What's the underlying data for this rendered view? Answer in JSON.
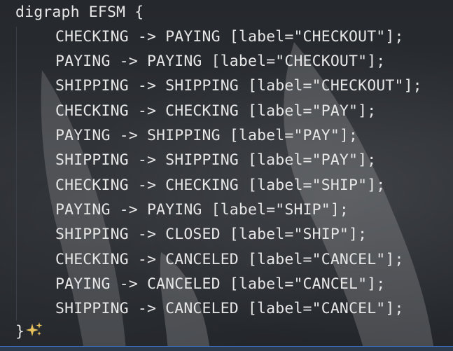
{
  "editor": {
    "header": "digraph EFSM {",
    "footer": "}",
    "lines": [
      "CHECKING -> PAYING [label=\"CHECKOUT\"];",
      "PAYING -> PAYING [label=\"CHECKOUT\"];",
      "SHIPPING -> SHIPPING [label=\"CHECKOUT\"];",
      "CHECKING -> CHECKING [label=\"PAY\"];",
      "PAYING -> SHIPPING [label=\"PAY\"];",
      "SHIPPING -> SHIPPING [label=\"PAY\"];",
      "CHECKING -> CHECKING [label=\"SHIP\"];",
      "PAYING -> PAYING [label=\"SHIP\"];",
      "SHIPPING -> CLOSED [label=\"SHIP\"];",
      "CHECKING -> CANCELED [label=\"CANCEL\"];",
      "PAYING -> CANCELED [label=\"CANCEL\"];",
      "SHIPPING -> CANCELED [label=\"CANCEL\"];"
    ],
    "sparkle_icon": "sparkle-icon",
    "sparkle_color": "#e8c25a",
    "accent": "#3c6bb0"
  }
}
